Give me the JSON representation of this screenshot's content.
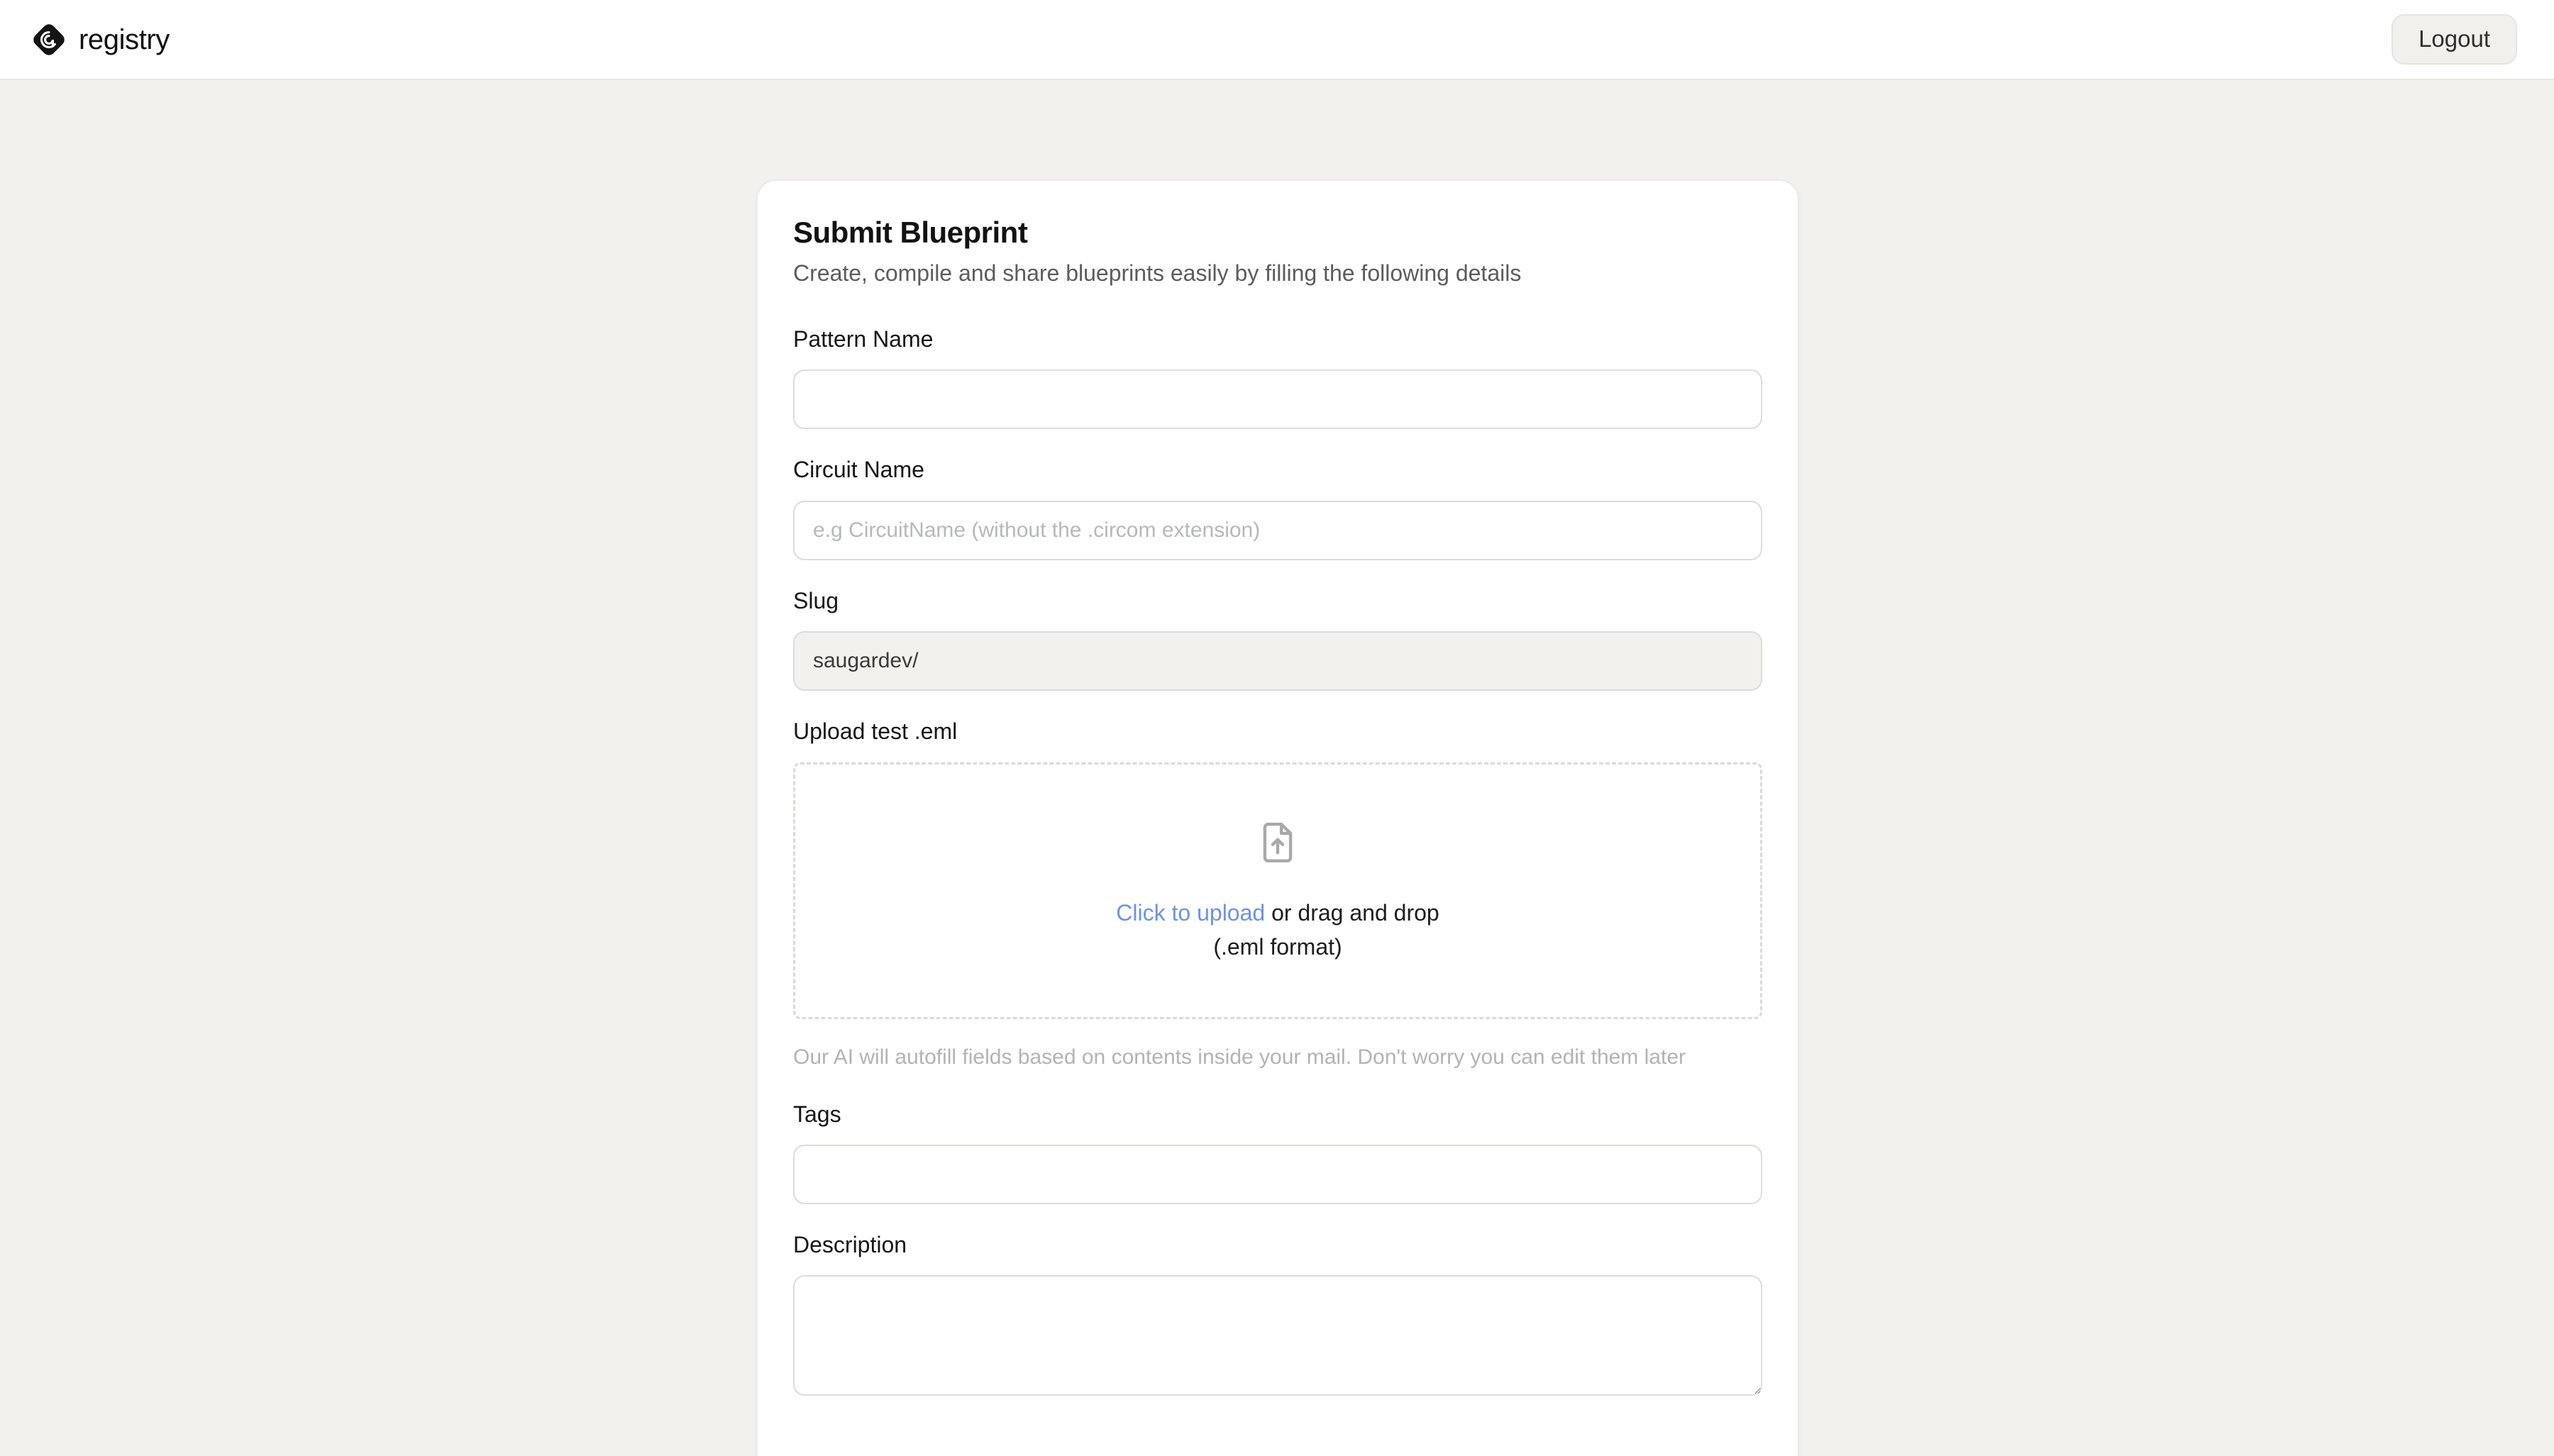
{
  "header": {
    "brand_name": "registry",
    "logo_icon": "registry-spiral-logo",
    "logout_label": "Logout"
  },
  "theme": {
    "page_background": "#f2f1ed",
    "card_background": "#ffffff",
    "link_blue": "#6d93e3",
    "border_gray": "#dedcd8",
    "muted_text": "#b3b3b3"
  },
  "card": {
    "title": "Submit Blueprint",
    "subtitle": "Create, compile and share blueprints easily by filling the following details",
    "fields": {
      "pattern_name": {
        "label": "Pattern Name",
        "value": "",
        "placeholder": ""
      },
      "circuit_name": {
        "label": "Circuit Name",
        "value": "",
        "placeholder": "e.g CircuitName (without the .circom extension)"
      },
      "slug": {
        "label": "Slug",
        "value": "saugardev/",
        "placeholder": ""
      },
      "upload": {
        "label": "Upload test .eml",
        "icon": "file-upload-icon",
        "link_text": "Click to upload",
        "rest_text": " or drag and drop",
        "format_text": "(.eml format)",
        "helper_text": "Our AI will autofill fields based on contents inside your mail. Don't worry you can edit them later"
      },
      "tags": {
        "label": "Tags",
        "value": "",
        "placeholder": ""
      },
      "description": {
        "label": "Description",
        "value": "",
        "placeholder": ""
      }
    }
  }
}
